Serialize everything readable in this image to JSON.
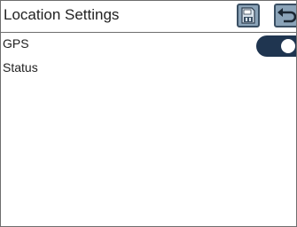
{
  "header": {
    "title": "Location Settings",
    "save_icon": "sd-card-save-icon",
    "back_icon": "back-arrow-icon"
  },
  "settings": {
    "gps": {
      "label": "GPS",
      "enabled": true
    },
    "status": {
      "label": "Status"
    }
  },
  "colors": {
    "toggle_on": "#1f3550",
    "button_fill": "#8aa3b8",
    "button_border": "#3a4f63",
    "border": "#6e6e6e"
  }
}
